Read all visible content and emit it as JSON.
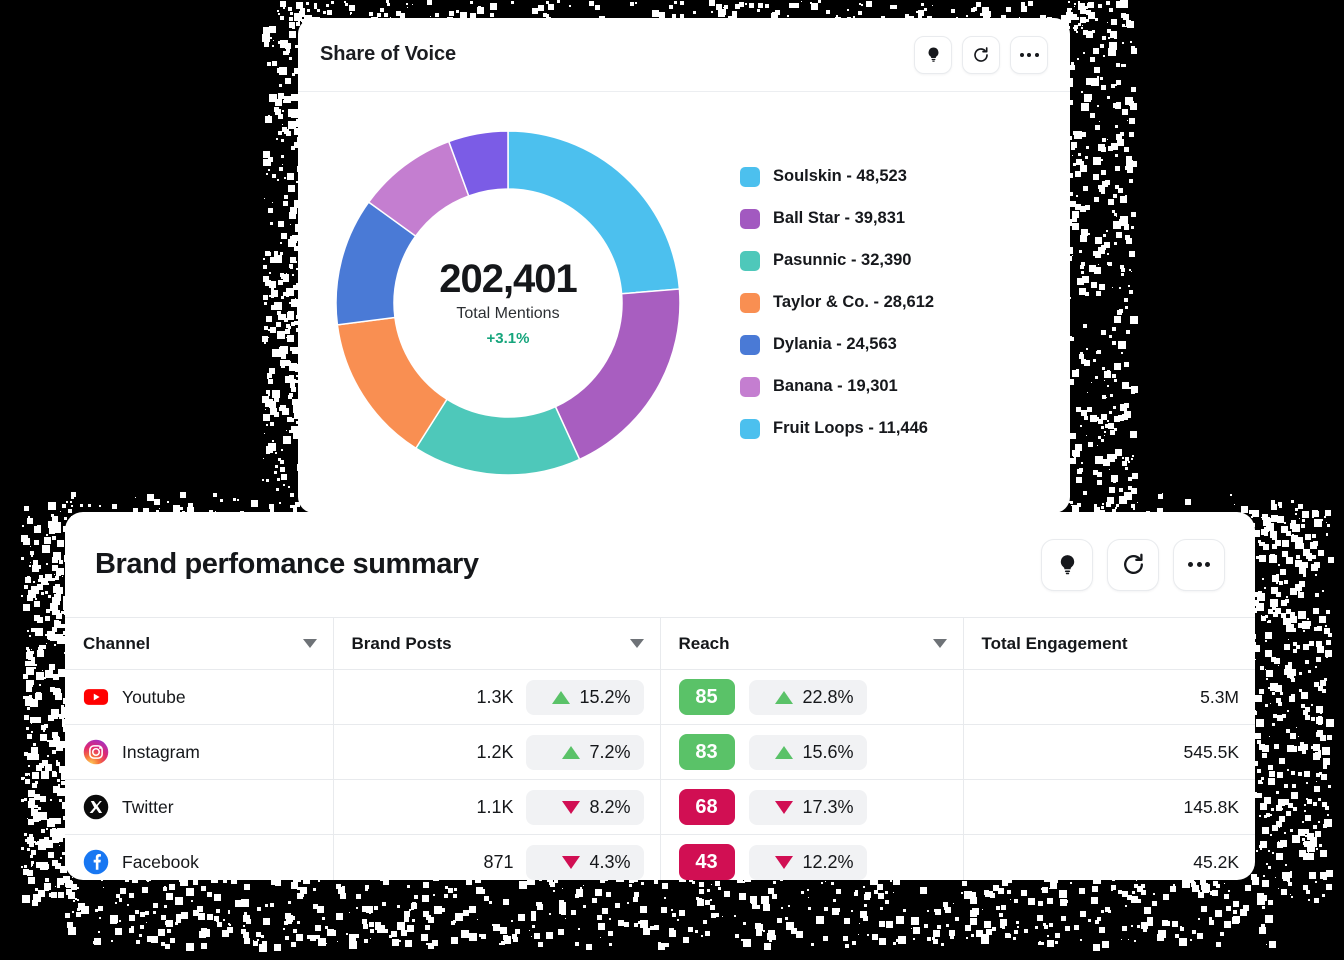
{
  "share_of_voice": {
    "title": "Share of Voice",
    "actions": [
      {
        "name": "insights-button",
        "icon": "lightbulb-icon"
      },
      {
        "name": "refresh-button",
        "icon": "refresh-icon"
      },
      {
        "name": "more-options-button",
        "icon": "ellipsis-icon"
      }
    ],
    "center": {
      "total": "202,401",
      "label": "Total Mentions",
      "delta": "+3.1%",
      "delta_color": "#16a57c"
    }
  },
  "chart_data": {
    "type": "pie",
    "title": "Share of Voice",
    "subtitle": "Total Mentions",
    "center_value": 202401,
    "center_label": "Total Mentions",
    "center_delta": "+3.1%",
    "legend_position": "right",
    "categories": [
      "Soulskin",
      "Ball Star",
      "Pasunnic",
      "Taylor & Co.",
      "Dylania",
      "Banana",
      "Fruit Loops"
    ],
    "values": [
      48523,
      39831,
      32390,
      28612,
      24563,
      19301,
      11446
    ],
    "labels": [
      "Soulskin - 48,523",
      "Ball Star - 39,831",
      "Pasunnic - 32,390",
      "Taylor & Co. - 28,612",
      "Dylania - 24,563",
      "Banana - 19,301",
      "Fruit Loops - 11,446"
    ],
    "legend_colors": [
      "#4cc0ee",
      "#a259c0",
      "#4ec8ba",
      "#f98f52",
      "#4a7ad6",
      "#c47ed0",
      "#4cc0ee"
    ],
    "slice_colors": [
      "#4cc0ee",
      "#a85ec0",
      "#4ec8ba",
      "#f98f52",
      "#4a7ad6",
      "#c47ed0",
      "#7b5ce6"
    ]
  },
  "brand_summary": {
    "title": "Brand perfomance summary",
    "actions": [
      {
        "name": "insights-button",
        "icon": "lightbulb-icon"
      },
      {
        "name": "refresh-button",
        "icon": "refresh-icon"
      },
      {
        "name": "more-options-button",
        "icon": "ellipsis-icon"
      }
    ],
    "columns": [
      {
        "label": "Channel",
        "sortable": true
      },
      {
        "label": "Brand Posts",
        "sortable": true
      },
      {
        "label": "Reach",
        "sortable": true
      },
      {
        "label": "Total Engagement",
        "sortable": false
      }
    ],
    "rows": [
      {
        "channel": "Youtube",
        "icon": "youtube-icon",
        "brand_posts": "1.3K",
        "brand_posts_change": "15.2%",
        "brand_posts_dir": "up",
        "reach": "85",
        "reach_state": "good",
        "reach_change": "22.8%",
        "reach_dir": "up",
        "total_engagement": "5.3M"
      },
      {
        "channel": "Instagram",
        "icon": "instagram-icon",
        "brand_posts": "1.2K",
        "brand_posts_change": "7.2%",
        "brand_posts_dir": "up",
        "reach": "83",
        "reach_state": "good",
        "reach_change": "15.6%",
        "reach_dir": "up",
        "total_engagement": "545.5K"
      },
      {
        "channel": "Twitter",
        "icon": "twitter-x-icon",
        "brand_posts": "1.1K",
        "brand_posts_change": "8.2%",
        "brand_posts_dir": "down",
        "reach": "68",
        "reach_state": "bad",
        "reach_change": "17.3%",
        "reach_dir": "down",
        "total_engagement": "145.8K"
      },
      {
        "channel": "Facebook",
        "icon": "facebook-icon",
        "brand_posts": "871",
        "brand_posts_change": "4.3%",
        "brand_posts_dir": "down",
        "reach": "43",
        "reach_state": "bad",
        "reach_change": "12.2%",
        "reach_dir": "down",
        "total_engagement": "45.2K"
      }
    ]
  },
  "theme": {
    "background": "#000000",
    "card": "#ffffff",
    "positive": "#5ac268",
    "negative": "#d10f53",
    "delta_positive": "#16a57c"
  }
}
